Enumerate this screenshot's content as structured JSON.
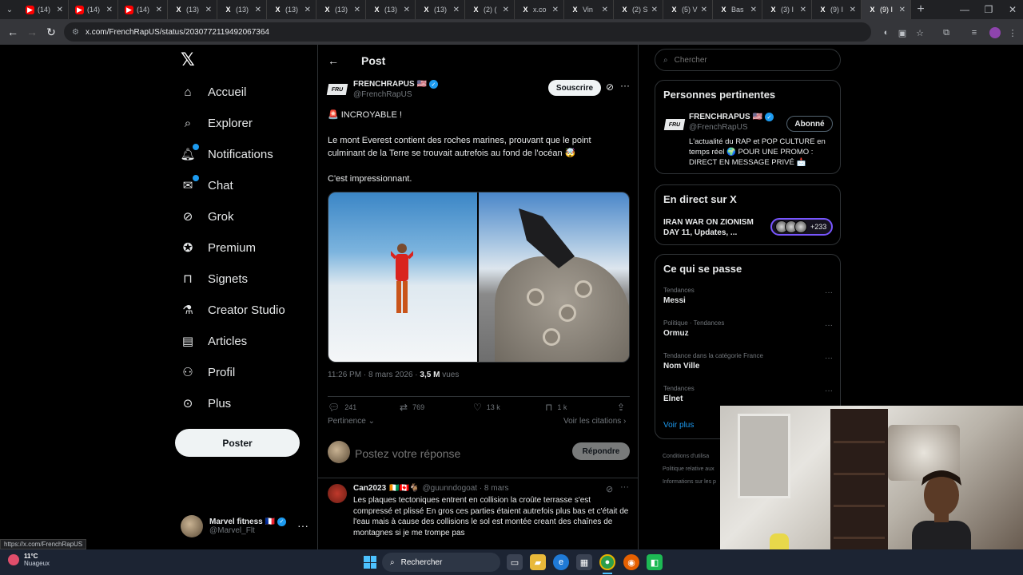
{
  "browser": {
    "tabs": [
      {
        "label": "(14)",
        "favicon": "youtube-icon"
      },
      {
        "label": "(14)",
        "favicon": "youtube-icon"
      },
      {
        "label": "(14)",
        "favicon": "youtube-icon"
      },
      {
        "label": "(13)",
        "favicon": "x-icon"
      },
      {
        "label": "(13)",
        "favicon": "x-icon"
      },
      {
        "label": "(13)",
        "favicon": "x-icon"
      },
      {
        "label": "(13)",
        "favicon": "x-icon"
      },
      {
        "label": "(13)",
        "favicon": "x-icon"
      },
      {
        "label": "(13)",
        "favicon": "x-icon"
      },
      {
        "label": "(2) (",
        "favicon": "x-icon"
      },
      {
        "label": "x.co",
        "favicon": "x-icon"
      },
      {
        "label": "Vin",
        "favicon": "x-icon"
      },
      {
        "label": "(2) S",
        "favicon": "x-icon"
      },
      {
        "label": "(5) V",
        "favicon": "x-icon"
      },
      {
        "label": "Bas",
        "favicon": "x-icon"
      },
      {
        "label": "(3) I",
        "favicon": "x-icon"
      },
      {
        "label": "(9) I",
        "favicon": "x-icon"
      },
      {
        "label": "(9) I",
        "favicon": "x-icon",
        "active": true
      }
    ],
    "url": "x.com/FrenchRapUS/status/2030772119492067364",
    "status_url": "https://x.com/FrenchRapUS"
  },
  "nav": {
    "items": [
      {
        "label": "Accueil",
        "icon": "home-icon"
      },
      {
        "label": "Explorer",
        "icon": "search-icon"
      },
      {
        "label": "Notifications",
        "icon": "bell-icon"
      },
      {
        "label": "Chat",
        "icon": "mail-icon"
      },
      {
        "label": "Grok",
        "icon": "grok-icon"
      },
      {
        "label": "Premium",
        "icon": "premium-icon"
      },
      {
        "label": "Signets",
        "icon": "bookmark-icon"
      },
      {
        "label": "Creator Studio",
        "icon": "flask-icon"
      },
      {
        "label": "Articles",
        "icon": "article-icon"
      },
      {
        "label": "Profil",
        "icon": "person-icon"
      },
      {
        "label": "Plus",
        "icon": "more-circle-icon"
      }
    ],
    "post_button": "Poster",
    "account": {
      "name": "Marvel fitness 🇫🇷",
      "handle": "@Marvel_Flt"
    }
  },
  "post": {
    "header": "Post",
    "author_name": "FRENCHRAPUS 🇺🇸",
    "author_handle": "@FrenchRapUS",
    "subscribe": "Souscrire",
    "line1": "🚨 INCROYABLE !",
    "line2": "Le mont Everest contient des roches marines, prouvant que le point culminant de la Terre se trouvait autrefois au fond de l'océan 🤯",
    "line3": "C'est impressionnant.",
    "time": "11:26 PM · 8 mars 2026 · ",
    "views_count": "3,5 M",
    "views_label": " vues",
    "stats": {
      "replies": "241",
      "reposts": "769",
      "likes": "13 k",
      "bookmarks": "1 k"
    },
    "sort": "Pertinence",
    "citations": "Voir les citations",
    "reply_placeholder": "Postez votre réponse",
    "reply_button": "Répondre"
  },
  "reply": {
    "name": "Can2023",
    "flags": "🇨🇮🇨🇦🐐",
    "handle": "@guunndogoat · 8 mars",
    "text": "Les plaques tectoniques entrent en collision la croûte terrasse s'est compressé et plissé En gros ces parties étaient autrefois plus bas et c'était de l'eau mais à cause des collisions le sol est montée creant  des chaînes de montagnes si je me trompe pas"
  },
  "sidebar": {
    "search_placeholder": "Chercher",
    "relevant": {
      "title": "Personnes pertinentes",
      "name": "FRENCHRAPUS 🇺🇸",
      "handle": "@FrenchRapUS",
      "follow": "Abonné",
      "bio": "L'actualité du RAP et POP CULTURE en temps réel 🌍 POUR UNE PROMO : DIRECT EN MESSAGE PRIVÉ 📩"
    },
    "live": {
      "title": "En direct sur X",
      "event": "IRAN WAR ON ZIONISM DAY 11, Updates, ...",
      "count": "+233"
    },
    "trending": {
      "title": "Ce qui se passe",
      "items": [
        {
          "category": "Tendances",
          "name": "Messi"
        },
        {
          "category": "Politique · Tendances",
          "name": "Ormuz"
        },
        {
          "category": "Tendance dans la catégorie France",
          "name": "Nom Ville"
        },
        {
          "category": "Tendances",
          "name": "Elnet"
        }
      ],
      "more": "Voir plus"
    },
    "footer": [
      "Conditions d'utilisa",
      "Politique relative aux",
      "Informations sur les p"
    ]
  },
  "taskbar": {
    "temp": "11°C",
    "weather": "Nuageux",
    "search": "Rechercher"
  },
  "colors": {
    "accent": "#1d9bf0",
    "background": "#000000",
    "live_border": "#7856ff"
  }
}
